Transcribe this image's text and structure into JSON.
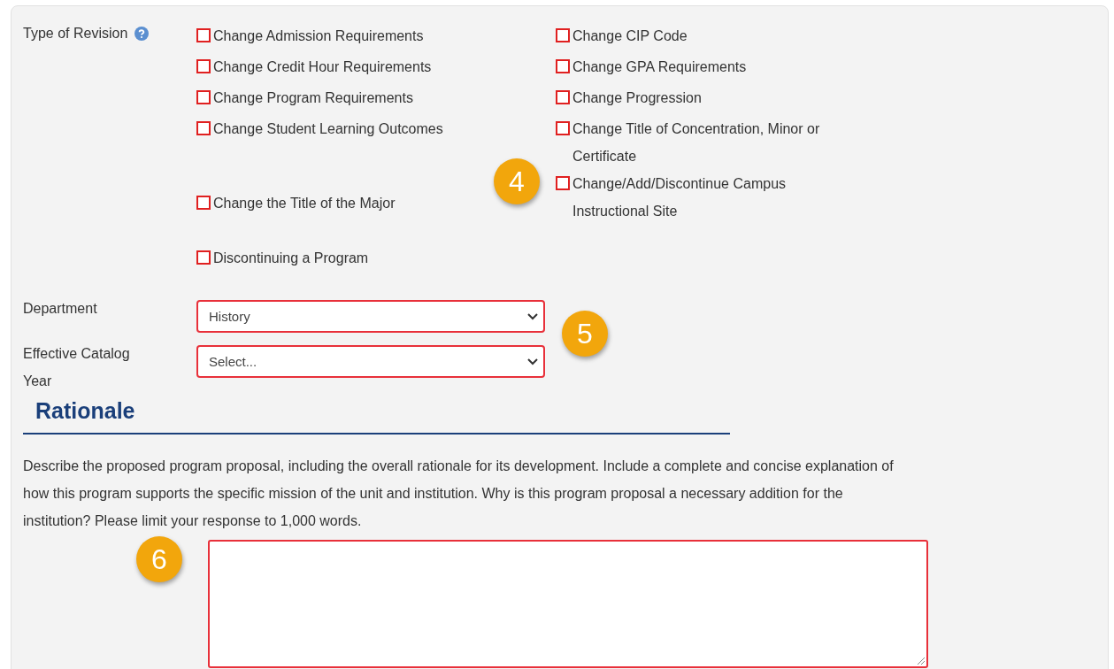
{
  "revision": {
    "label": "Type of Revision",
    "rows": [
      {
        "left": {
          "label": "Change Admission Requirements",
          "checked": false
        },
        "right": {
          "label": "Change CIP Code",
          "checked": false
        }
      },
      {
        "left": {
          "label": "Change Credit Hour Requirements",
          "checked": false
        },
        "right": {
          "label": "Change GPA Requirements",
          "checked": false
        }
      },
      {
        "left": {
          "label": "Change Program Requirements",
          "checked": false
        },
        "right": {
          "label": "Change Progression",
          "checked": false
        }
      },
      {
        "left": {
          "label": "Change Student Learning Outcomes",
          "checked": false
        },
        "right": {
          "label": "Change Title of Concentration, Minor or Certificate",
          "checked": false
        }
      },
      {
        "left": {
          "label": "Change the Title of the Major",
          "checked": false
        },
        "right": {
          "label": "Change/Add/Discontinue Campus Instructional Site",
          "checked": false
        }
      },
      {
        "left": {
          "label": "Discontinuing a Program",
          "checked": false
        }
      }
    ]
  },
  "fields": [
    {
      "label": "Department",
      "value": "History"
    },
    {
      "label": "Effective Catalog Year",
      "value": "Select..."
    }
  ],
  "section": {
    "title": "Rationale",
    "description": "Describe the proposed program proposal, including the overall rationale for its development. Include a complete and concise explanation of how this program supports the specific mission of the unit and institution. Why is this program proposal a necessary addition for the institution? Please limit your response to 1,000 words."
  },
  "callouts": [
    "4",
    "5",
    "6"
  ]
}
